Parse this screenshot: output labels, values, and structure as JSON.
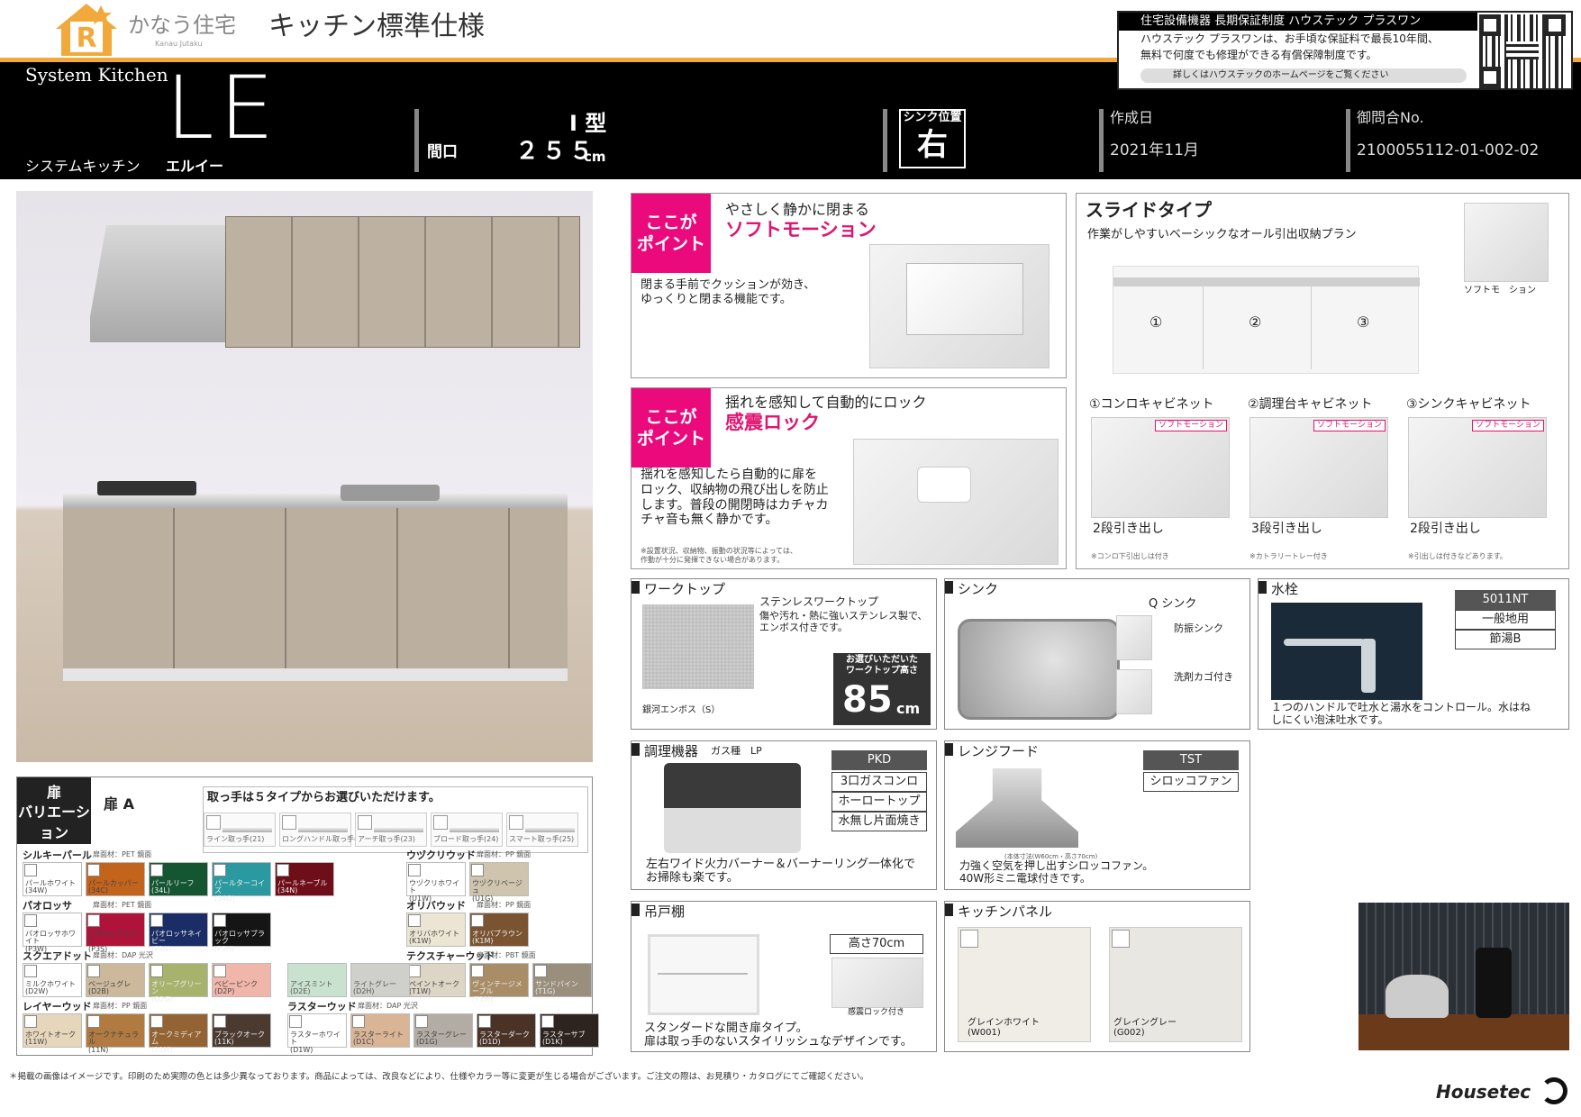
{
  "header": {
    "logo": "かなう住宅",
    "logo_sub": "Kanau Jutaku",
    "title": "キッチン標準仕様"
  },
  "warranty": {
    "title": "住宅設備機器 長期保証制度 ハウステック プラスワン",
    "line1": "ハウステック プラスワンは、お手頃な保証料で最長10年間、",
    "line2": "無料で何度でも修理ができる有償保障制度です。",
    "link": "詳しくはハウステックのホームページをご覧ください"
  },
  "banner": {
    "system_kitchen": "System Kitchen",
    "logo": "LE",
    "jp": "システムキッチン",
    "jp_name": "エルイー",
    "type": "I 型",
    "width_label": "間口",
    "width_value": "２５５",
    "width_unit": "cm",
    "sink_label": "シンク位置",
    "sink_value": "右",
    "date_label": "作成日",
    "date_value": "2021年11月",
    "inquiry_label": "御問合No.",
    "inquiry_value": "2100055112-01-002-02"
  },
  "point1": {
    "badge": "ここが\nポイント",
    "sub": "やさしく静かに閉まる",
    "title": "ソフトモーション",
    "desc": "閉まる手前でクッションが効き、\nゆっくりと閉まる機能です。"
  },
  "point2": {
    "badge": "ここが\nポイント",
    "sub": "揺れを感知して自動的にロック",
    "title": "感震ロック",
    "desc": "揺れを感知したら自動的に扉を\nロック、収納物の飛び出しを防止\nします。普段の開閉時はカチャカ\nチャ音も無く静かです。",
    "note": "※設置状況、収納物、振動の状況等によっては、\n作動が十分に発揮できない場合があります。"
  },
  "slide": {
    "title": "スライドタイプ",
    "sub": "作業がしやすいベーシックなオール引出収納プラン",
    "img_caption": "ソフトモ　ション",
    "nums": [
      "①",
      "②",
      "③"
    ],
    "cabinets": [
      {
        "name": "①コンロキャビネット",
        "tag": "ソフトモーション",
        "drawers": "2段引き出し",
        "note": "※コンロ下引出しは付き"
      },
      {
        "name": "②調理台キャビネット",
        "tag": "ソフトモーション",
        "drawers": "3段引き出し",
        "note": "※カトラリートレー付き"
      },
      {
        "name": "③シンクキャビネット",
        "tag": "ソフトモーション",
        "drawers": "2段引き出し",
        "note": "※引出しは付きなどあります。"
      }
    ]
  },
  "worktop": {
    "head": "ワークトップ",
    "name": "ステンレスワークトップ",
    "desc": "傷や汚れ・熱に強いステンレス製で、\nエンボス付きです。",
    "swatch": "銀河エンボス（S）",
    "height_label": "お選びいただいた\nワークトップ高さ",
    "height_value": "85",
    "height_unit": "cm"
  },
  "sink": {
    "head": "シンク",
    "name": "Q シンク",
    "feature1": "防振シンク",
    "feature2": "洗剤カゴ付き"
  },
  "faucet": {
    "head": "水栓",
    "code": "5011NT",
    "opt1": "一般地用",
    "opt2": "節湯B",
    "desc": "１つのハンドルで吐水と湯水をコントロール。水はね\nしにくい泡沫吐水です。"
  },
  "cooking": {
    "head": "調理機器",
    "head_sub": "ガス種　LP",
    "code": "PKD",
    "spec1": "3口ガスコンロ",
    "spec2": "ホーロートップ",
    "spec3": "水無し片面焼き",
    "desc": "左右ワイド火力バーナー＆バーナーリング一体化で\nお掃除も楽です。"
  },
  "hood": {
    "head": "レンジフード",
    "code": "TST",
    "spec1": "シロッコファン",
    "note": "(本体寸法(W60cm・高さ70cm)",
    "desc": "力強く空気を押し出すシロッコファン。\n40W形ミニ電球付きです。"
  },
  "cupboard": {
    "head": "吊戸棚",
    "height": "高さ70cm",
    "lock": "感震ロック付き",
    "desc": "スタンダードな開き扉タイプ。\n扉は取っ手のないスタイリッシュなデザインです。"
  },
  "panel": {
    "head": "キッチンパネル",
    "items": [
      {
        "name": "グレインホワイト\n(W001)",
        "color": "#f0ede7"
      },
      {
        "name": "グレイングレー\n(G002)",
        "color": "#e9e7e2"
      }
    ]
  },
  "doors": {
    "badge": "扉\nバリエーション",
    "door_label": "扉 A",
    "handle_title": "取っ手は５タイプからお選びいただけます。",
    "handles": [
      "ライン取っ手(21)",
      "ロングハンドル取っ手(22)",
      "アーチ取っ手(23)",
      "ブロード取っ手(24)",
      "スマート取っ手(25)"
    ],
    "groups": [
      {
        "name": "シルキーパール",
        "mat": "扉面材：PET 鏡面",
        "items": [
          {
            "label": "パールホワイト\n(34W)",
            "color": "#ffffff"
          },
          {
            "label": "パールカッパー\n(34C)",
            "color": "#c2641c"
          },
          {
            "label": "パールリーフ\n(34L)",
            "color": "#145632"
          },
          {
            "label": "パールターコイズ\n(34Q)",
            "color": "#2a9aa0"
          },
          {
            "label": "パールネーブル\n(34N)",
            "color": "#6e0e18"
          }
        ]
      },
      {
        "name": "パオロッサ",
        "mat": "扉面材：PET 鏡面",
        "items": [
          {
            "label": "パオロッサホワイト\n(P3W)",
            "color": "#ffffff"
          },
          {
            "label": "パオロッサレッド\n(P3S)",
            "color": "#b0133a"
          },
          {
            "label": "パオロッサネイビー\n(P3A)",
            "color": "#1b2d66"
          },
          {
            "label": "パオロッサブラック\n(P3H)",
            "color": "#151515"
          }
        ]
      },
      {
        "name": "スクエアドット",
        "mat": "扉面材：DAP 光沢",
        "items": [
          {
            "label": "ミルクホワイト\n(D2W)",
            "color": "#ffffff"
          },
          {
            "label": "ベージュグレ\n(D2B)",
            "color": "#ccb99c"
          },
          {
            "label": "オリーブグリーン\n(D2G)",
            "color": "#a7b36c"
          },
          {
            "label": "ベビーピンク\n(D2P)",
            "color": "#f0b6aa"
          }
        ]
      },
      {
        "name": "レイヤーウッド",
        "mat": "扉面材：PP 鏡面",
        "items": [
          {
            "label": "ホワイトオーク\n(11W)",
            "color": "#e6d6bc"
          },
          {
            "label": "オークナチュラル\n(11N)",
            "color": "#b07a40"
          },
          {
            "label": "オークミディアム\n(11M)",
            "color": "#946333"
          },
          {
            "label": "ブラックオーク\n(11K)",
            "color": "#4a3a30"
          }
        ]
      },
      {
        "name": "ウヅクリウッド",
        "mat": "扉面材：PP 鏡面",
        "items": [
          {
            "label": "ウヅクリホワイト\n(U1W)",
            "color": "#ffffff"
          },
          {
            "label": "ウヅクリベージュ\n(U1G)",
            "color": "#cfc4ad"
          }
        ]
      },
      {
        "name": "オリバウッド",
        "mat": "扉面材：PP 鏡面",
        "items": [
          {
            "label": "オリバホワイト\n(K1W)",
            "color": "#ece5d3"
          },
          {
            "label": "オリバブラウン\n(K1M)",
            "color": "#7a5331"
          }
        ]
      },
      {
        "name": "テクスチャーウッド",
        "mat": "扉面材：PBT 鏡面",
        "items": [
          {
            "label": "ペイントオーク\n(T1W)",
            "color": "#ddd6c6"
          },
          {
            "label": "ヴィンテージメープル\n(T1M)",
            "color": "#a98d66"
          },
          {
            "label": "サンドパイン\n(T1G)",
            "color": "#9a8e7c"
          }
        ]
      },
      {
        "name": "ラスターウッド",
        "mat": "扉面材：DAP 光沢",
        "items": [
          {
            "label": "ラスターホワイト\n(D1W)",
            "color": "#ffffff"
          },
          {
            "label": "ラスターライト\n(D1C)",
            "color": "#d9b596"
          },
          {
            "label": "ラスターグレー\n(D1G)",
            "color": "#b3aca4"
          },
          {
            "label": "ラスターダーク\n(D1D)",
            "color": "#4a3227"
          },
          {
            "label": "ラスターサブ\n(D1K)",
            "color": "#2e241f"
          }
        ]
      }
    ],
    "extra": [
      {
        "label": "アイスミント\n(D2E)",
        "color": "#c9e2cf"
      },
      {
        "label": "ライトグレー\n(D2H)",
        "color": "#cfd0cc"
      }
    ]
  },
  "footer": {
    "note": "＊掲載の画像はイメージです。印刷のため実際の色とは多少異なっております。商品によっては、改良などにより、仕様やカラー等に変更が生じる場合がございます。ご注文の際は、お見積り・カタログにてご確認ください。",
    "brand": "Housetec"
  }
}
